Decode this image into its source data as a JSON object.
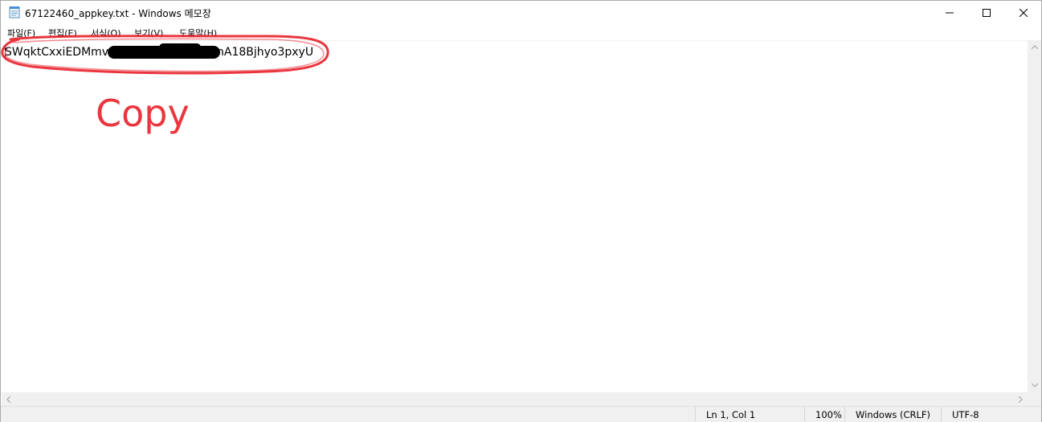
{
  "window": {
    "title": "67122460_appkey.txt - Windows 메모장"
  },
  "menu": [
    {
      "label": "파일(F)"
    },
    {
      "label": "편집(E)"
    },
    {
      "label": "서식(O)"
    },
    {
      "label": "보기(V)"
    },
    {
      "label": "도움말(H)"
    }
  ],
  "editor": {
    "text_start": "SWqktCxxiEDMmv",
    "text_end": "nA18Bjhyo3pxyU"
  },
  "annotation": {
    "label": "Copy",
    "color": "#e8202a"
  },
  "status": {
    "position": "Ln 1, Col 1",
    "zoom": "100%",
    "line_ending": "Windows (CRLF)",
    "encoding": "UTF-8"
  }
}
